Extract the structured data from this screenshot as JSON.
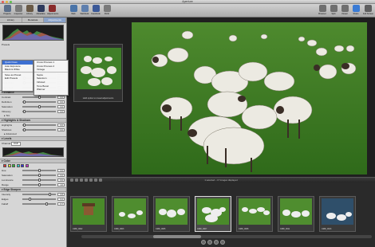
{
  "window": {
    "title": "Aperture"
  },
  "colors": {
    "selection": "#3d6fd1",
    "inspector_bg": "#d6d6d6",
    "viewer_bg": "#1f1f1f"
  },
  "toolbar": {
    "left": [
      {
        "label": "Projects",
        "icon": "projects-icon",
        "color": "#5b6f8a"
      },
      {
        "label": "Inspector",
        "icon": "inspector-icon",
        "color": "#7a7a7a"
      },
      {
        "label": "Library",
        "icon": "library-icon",
        "color": "#6a5a46"
      },
      {
        "label": "Metadata",
        "icon": "metadata-icon",
        "color": "#2e3a5c"
      },
      {
        "label": "Adjustments",
        "icon": "adjustments-icon",
        "color": "#8a2b2b"
      }
    ],
    "middle": [
      {
        "label": "Web",
        "icon": "web-icon",
        "color": "#4a74a8"
      },
      {
        "label": "Webbook",
        "icon": "webbook-icon",
        "color": "#5e7fae"
      },
      {
        "label": "Facebook",
        "icon": "facebook-icon",
        "color": "#3b5998"
      },
      {
        "label": "Flickr",
        "icon": "flickr-icon",
        "color": "#7a7a7a"
      }
    ],
    "right": [
      {
        "label": "Browser",
        "icon": "browser-icon",
        "color": "#6f6f6f"
      },
      {
        "label": "Split",
        "icon": "split-icon",
        "color": "#6f6f6f"
      },
      {
        "label": "Viewer",
        "icon": "viewer-icon",
        "color": "#6f6f6f"
      },
      {
        "label": "Share",
        "icon": "share-icon",
        "color": "#3a7bd5"
      },
      {
        "label": "Full Screen",
        "icon": "fullscreen-icon",
        "color": "#5f5f5f"
      }
    ]
  },
  "inspector": {
    "tabs": [
      {
        "label": "Library"
      },
      {
        "label": "Metadata"
      },
      {
        "label": "Adjustments"
      }
    ],
    "presets_label": "Presets",
    "rows1": [
      {
        "label": "Exposure",
        "value": "0.0"
      },
      {
        "label": "Recovery",
        "value": "0.0"
      },
      {
        "label": "Black Point",
        "value": "0.0"
      },
      {
        "label": "Brightness",
        "value": "0.0"
      }
    ],
    "enhance_title": "Enhance",
    "enhance_rows": [
      {
        "label": "Contrast",
        "value": "0.0"
      },
      {
        "label": "Definition",
        "value": "0.0"
      },
      {
        "label": "Saturation",
        "value": "0.0"
      },
      {
        "label": "Vibrancy",
        "value": "0.0"
      }
    ],
    "tint_label": "Tint",
    "highlights_title": "Highlights & Shadows",
    "hs_rows": [
      {
        "label": "Highlights",
        "value": "0.0"
      },
      {
        "label": "Shadows",
        "value": "0.0"
      }
    ],
    "advanced_label": "Advanced",
    "levels_title": "Levels",
    "channel_label": "Channel:",
    "channel_value": "RGB",
    "color_title": "Color",
    "color_rows": [
      {
        "label": "Hue",
        "value": "0.0"
      },
      {
        "label": "Saturation",
        "value": "0.0"
      },
      {
        "label": "Luminance",
        "value": "0.0"
      },
      {
        "label": "Range",
        "value": "1.0"
      }
    ],
    "edge_title": "Edge Sharpen",
    "edge_rows": [
      {
        "label": "Intensity",
        "value": "0.8"
      },
      {
        "label": "Edges",
        "value": "0.2"
      },
      {
        "label": "Falloff",
        "value": "0.7"
      }
    ]
  },
  "menu1": [
    {
      "label": "Quick Fixes",
      "selected": true
    },
    {
      "label": "Auto Exposure",
      "selected": false
    },
    {
      "label": "Black & White",
      "selected": false
    },
    {
      "label": "",
      "selected": false
    },
    {
      "label": "Save as Preset",
      "selected": false
    },
    {
      "label": "Edit Presets",
      "selected": false
    }
  ],
  "menu2": [
    {
      "label": "Cross Process 1"
    },
    {
      "label": "Cross Process 2"
    },
    {
      "label": "Vintage"
    },
    {
      "label": ""
    },
    {
      "label": "Sepia"
    },
    {
      "label": "Selenium"
    },
    {
      "label": "Infrared"
    },
    {
      "label": "Tone Boost"
    },
    {
      "label": "Warmer"
    },
    {
      "label": "Cooler"
    }
  ],
  "loupe": {
    "caption": "Hold option to reveal adjustments"
  },
  "filmstrip": {
    "info": "1 selected – 17 images displayed",
    "thumbs": [
      {
        "name": "CRW_0002"
      },
      {
        "name": "CRW_0003"
      },
      {
        "name": "CRW_0005"
      },
      {
        "name": "CRW_0007"
      },
      {
        "name": "CRW_0008"
      },
      {
        "name": "CRW_0011"
      },
      {
        "name": "CRW_0013"
      }
    ]
  }
}
